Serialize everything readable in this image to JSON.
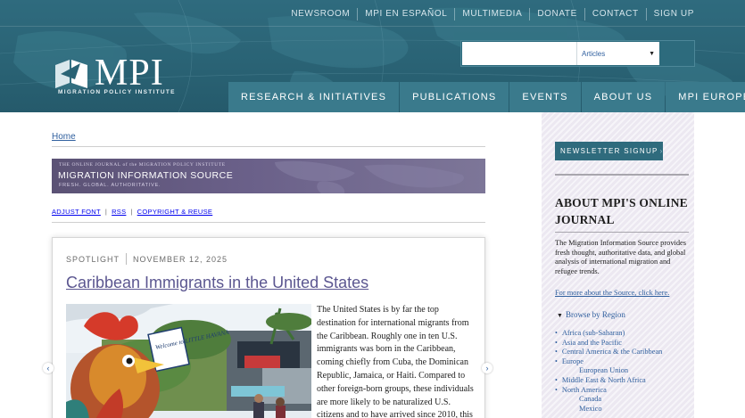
{
  "utility_nav": [
    "NEWSROOM",
    "MPI EN ESPAÑOL",
    "MULTIMEDIA",
    "DONATE",
    "CONTACT",
    "SIGN UP"
  ],
  "logo": {
    "name": "MPI",
    "subtitle": "MIGRATION POLICY INSTITUTE"
  },
  "search": {
    "placeholder": "",
    "select_value": "Articles"
  },
  "main_nav": [
    "RESEARCH & INITIATIVES",
    "PUBLICATIONS",
    "EVENTS",
    "ABOUT US",
    "MPI EUROPE"
  ],
  "breadcrumb": "Home",
  "source_banner": {
    "top_line": "THE ONLINE JOURNAL of the MIGRATION POLICY INSTITUTE",
    "title": "MIGRATION INFORMATION SOURCE",
    "tagline": "FRESH. GLOBAL. AUTHORITATIVE."
  },
  "tools": [
    "ADJUST FONT",
    "RSS",
    "COPYRIGHT & REUSE"
  ],
  "spotlight": {
    "label": "SPOTLIGHT",
    "date": "NOVEMBER 12, 2025",
    "title": "Caribbean Immigrants in the United States",
    "excerpt": "The United States is by far the top destination for international migrants from the Caribbean. Roughly one in ten U.S. immigrants was born in the Caribbean, coming chiefly from Cuba, the Dominican Republic, Jamaica, or Haiti. Compared to other foreign-born groups, these individuals are more likely to be naturalized U.S. citizens and to have arrived since 2010, this",
    "photo_sign": "Welcome to LITTLE HAVANA",
    "prev_icon": "chevron-left",
    "next_icon": "chevron-right"
  },
  "sidebar": {
    "newsletter_button": "NEWSLETTER SIGNUP",
    "about_heading": "ABOUT MPI'S ONLINE JOURNAL",
    "about_text": "The Migration Information Source provides fresh thought, authoritative data, and global analysis of international migration and refugee trends.",
    "more_link": "For more about the Source, click here.",
    "browse_label": "Browse by Region",
    "regions": [
      {
        "label": "Africa (sub-Saharan)",
        "level": 0
      },
      {
        "label": "Asia and the Pacific",
        "level": 0
      },
      {
        "label": "Central America & the Caribbean",
        "level": 0
      },
      {
        "label": "Europe",
        "level": 0
      },
      {
        "label": "European Union",
        "level": 1
      },
      {
        "label": "Middle East & North Africa",
        "level": 0
      },
      {
        "label": "North America",
        "level": 0
      },
      {
        "label": "Canada",
        "level": 1
      },
      {
        "label": "Mexico",
        "level": 1
      }
    ]
  },
  "colors": {
    "header_teal": "#2a6375",
    "nav_tab": "#3a7a8c",
    "link_blue": "#2f5f9e",
    "title_purple": "#5b5690",
    "banner_purple": "#6a6089",
    "sidebar_bg": "#ece8f1"
  }
}
